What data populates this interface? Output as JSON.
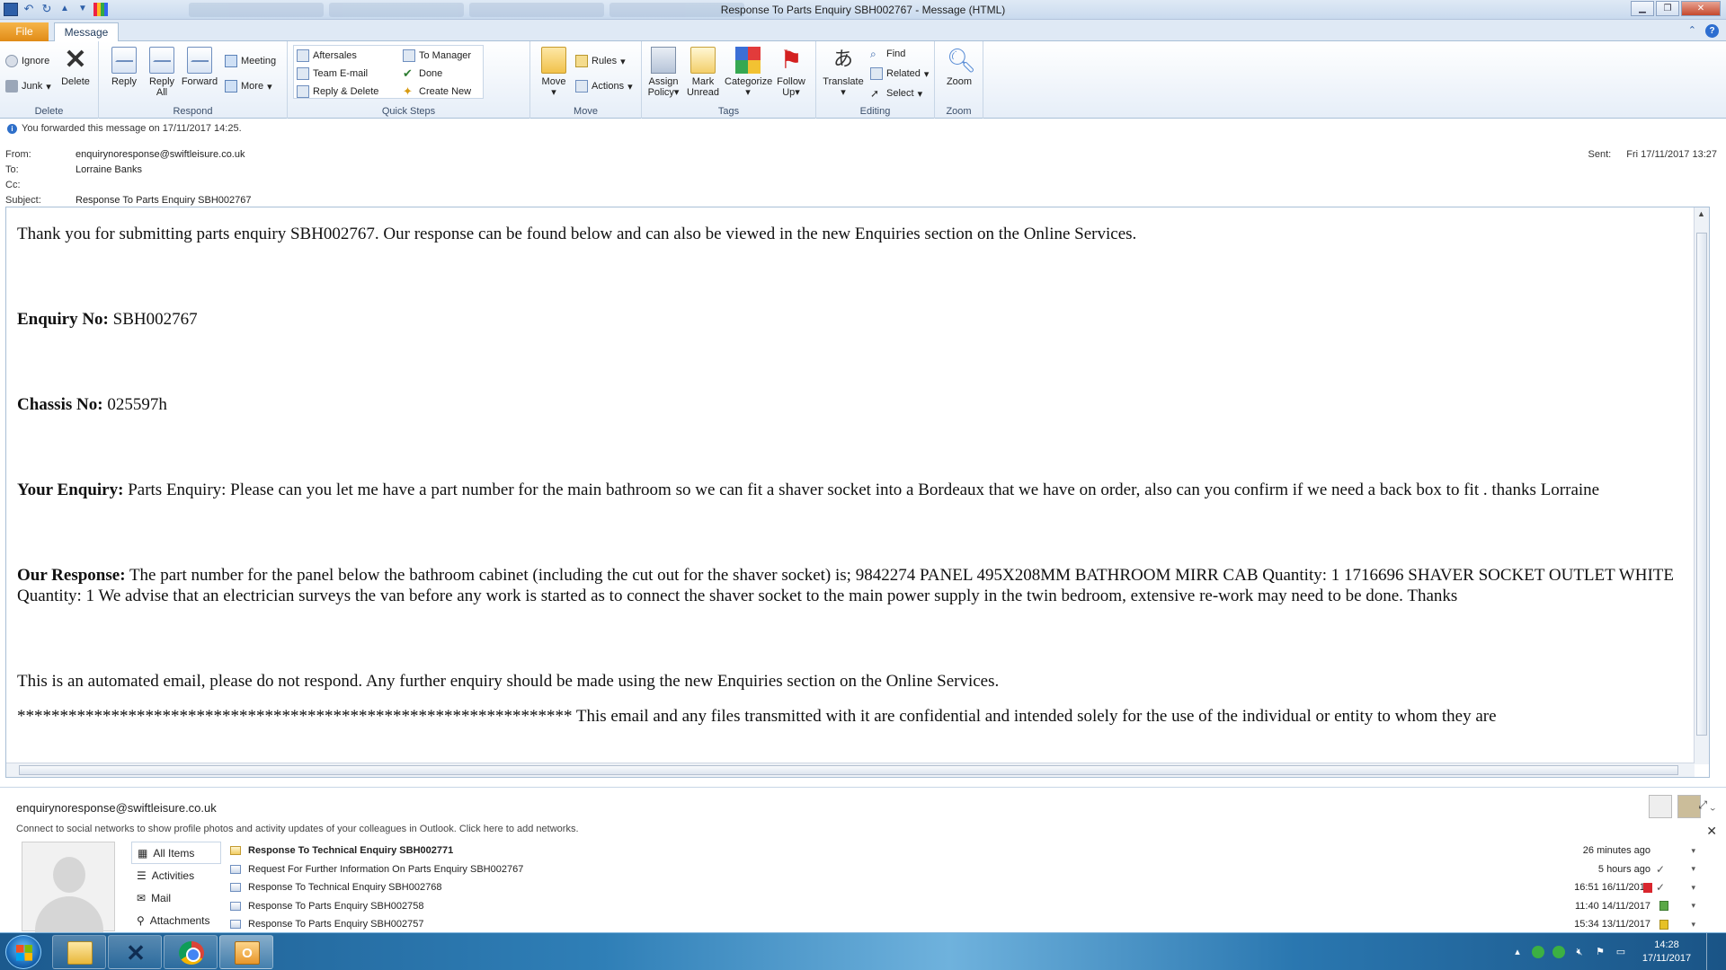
{
  "window": {
    "title": "Response To Parts Enquiry SBH002767  -  Message (HTML)"
  },
  "tabs": {
    "file": "File",
    "message": "Message"
  },
  "ribbon": {
    "delete": {
      "label": "Delete",
      "ignore": "Ignore",
      "junk": "Junk",
      "delete": "Delete"
    },
    "respond": {
      "label": "Respond",
      "reply": "Reply",
      "reply_all_1": "Reply",
      "reply_all_2": "All",
      "forward": "Forward",
      "meeting": "Meeting",
      "more": "More"
    },
    "quick_steps": {
      "label": "Quick Steps",
      "items": [
        "Aftersales",
        "Team E-mail",
        "Reply & Delete",
        "To Manager",
        "Done",
        "Create New"
      ]
    },
    "move": {
      "label": "Move",
      "move": "Move",
      "rules": "Rules",
      "actions": "Actions"
    },
    "tags": {
      "label": "Tags",
      "assign_1": "Assign",
      "assign_2": "Policy",
      "mark_1": "Mark",
      "mark_2": "Unread",
      "categorize": "Categorize",
      "follow_1": "Follow",
      "follow_2": "Up"
    },
    "editing": {
      "label": "Editing",
      "translate": "Translate",
      "find": "Find",
      "related": "Related",
      "select": "Select"
    },
    "zoom": {
      "label": "Zoom",
      "zoom": "Zoom"
    }
  },
  "message": {
    "info": "You forwarded this message on 17/11/2017 14:25.",
    "from_label": "From:",
    "from": "enquirynoresponse@swiftleisure.co.uk",
    "to_label": "To:",
    "to": "Lorraine Banks",
    "cc_label": "Cc:",
    "subject_label": "Subject:",
    "subject": "Response To Parts Enquiry SBH002767",
    "sent_label": "Sent:",
    "sent": "Fri 17/11/2017 13:27"
  },
  "body": {
    "intro": "Thank you for submitting parts enquiry SBH002767. Our response can be found below and can also be viewed in the new Enquiries section on the Online Services.",
    "enquiry_label": "Enquiry No:",
    "enquiry_value": " SBH002767",
    "chassis_label": "Chassis No:",
    "chassis_value": " 025597h",
    "your_enquiry_label": "Your Enquiry:",
    "your_enquiry_value": " Parts Enquiry: Please can you let me have a part number for the main bathroom so we can fit a shaver socket into a Bordeaux that we have on order, also can you confirm if we need a back box to fit . thanks Lorraine",
    "our_response_label": "Our Response:",
    "our_response_value": " The part number for the panel below the bathroom cabinet (including the cut out for the shaver socket) is; 9842274 PANEL 495X208MM BATHROOM MIRR CAB Quantity: 1 1716696 SHAVER SOCKET OUTLET WHITE Quantity: 1 We advise that an electrician surveys the van before any work is started as to connect the shaver socket to the main power supply in the twin bedroom, extensive re-work may need to be done. Thanks",
    "automated": "This is an automated email, please do not respond. Any further enquiry should be made using the new Enquiries section on the Online Services.",
    "disclaimer": "***************************************************************** This email and any files transmitted with it are confidential and intended solely for the use of the individual or entity to whom they are"
  },
  "people_pane": {
    "email": "enquirynoresponse@swiftleisure.co.uk",
    "social_prompt": "Connect to social networks to show profile photos and activity updates of your colleagues in Outlook. Click here to add networks.",
    "nav": [
      "All Items",
      "Activities",
      "Mail",
      "Attachments"
    ],
    "items": [
      {
        "subject": "Response To Technical Enquiry SBH002771",
        "time": "26 minutes ago",
        "bold": true,
        "mark_color": ""
      },
      {
        "subject": "Request For Further Information On Parts Enquiry SBH002767",
        "time": "5 hours ago",
        "bold": false,
        "mark_color": ""
      },
      {
        "subject": "Response To Technical Enquiry SBH002768",
        "time": "16:51  16/11/2017",
        "bold": false,
        "mark_color": "#d9262e"
      },
      {
        "subject": "Response To Parts Enquiry SBH002758",
        "time": "11:40  14/11/2017",
        "bold": false,
        "mark_color": "#5aa846"
      },
      {
        "subject": "Response To Parts Enquiry SBH002757",
        "time": "15:34  13/11/2017",
        "bold": false,
        "mark_color": "#e6c126"
      }
    ]
  },
  "taskbar": {
    "time": "14:28",
    "date": "17/11/2017"
  }
}
